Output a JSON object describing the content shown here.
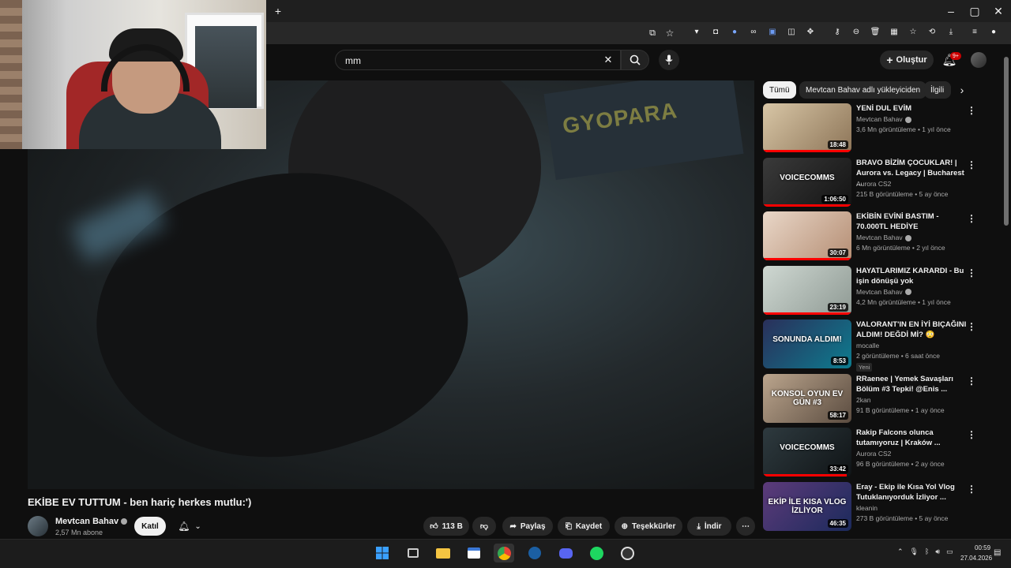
{
  "browser": {
    "new_tab_label": "+",
    "window_controls": [
      "minimize",
      "maximize",
      "close"
    ]
  },
  "youtube": {
    "search_value": "mm",
    "create_label": "Oluştur",
    "notification_badge": "9+"
  },
  "video": {
    "title": "EKİBE EV TUTTUM - ben hariç herkes mutlu:')",
    "sign_text": "GYOPARA",
    "channel_name": "Mevtcan Bahav",
    "subscribers": "2,57 Mn abone",
    "join_label": "Katıl",
    "likes": "113 B",
    "share_label": "Paylaş",
    "save_label": "Kaydet",
    "thanks_label": "Teşekkürler",
    "download_label": "İndir"
  },
  "chips": [
    "Tümü",
    "Mevtcan Bahav adlı yükleyiciden",
    "İlgili"
  ],
  "recommendations": [
    {
      "title": "YENİ DUL EVİM",
      "channel": "Mevtcan Bahav",
      "verified": true,
      "meta": "3,6 Mn görüntüleme • 1 yıl önce",
      "duration": "18:48",
      "progress": 1.0,
      "thumb": "linear-gradient(135deg,#d8c6a6,#8d7558)"
    },
    {
      "title": "BRAVO BİZİM ÇOCUKLAR! | Aurora vs. Legacy | Bucharest ...",
      "channel": "Aurora CS2",
      "verified": false,
      "meta": "215 B görüntüleme • 5 ay önce",
      "duration": "1:06:50",
      "progress": 1.0,
      "thumb_text": "VOICECOMMS",
      "thumb": "linear-gradient(135deg,#3a3a3a,#141414)"
    },
    {
      "title": "EKİBİN EVİNİ BASTIM - 70.000TL HEDİYE",
      "channel": "Mevtcan Bahav",
      "verified": true,
      "meta": "6 Mn görüntüleme • 2 yıl önce",
      "duration": "30:07",
      "progress": 1.0,
      "thumb": "linear-gradient(135deg,#e9d7c8,#b58e74)"
    },
    {
      "title": "HAYATLARIMIZ KARARDI - Bu işin dönüşü yok",
      "channel": "Mevtcan Bahav",
      "verified": true,
      "meta": "4,2 Mn görüntüleme • 1 yıl önce",
      "duration": "23:19",
      "progress": 1.0,
      "thumb": "linear-gradient(135deg,#cfd8d2,#8f9a94)"
    },
    {
      "title": "VALORANT'IN EN İYİ BIÇAĞINI ALDIM! DEĞDİ Mİ? 😳",
      "channel": "mocalle",
      "verified": false,
      "meta": "2 görüntüleme • 6 saat önce",
      "new": "Yeni",
      "duration": "8:53",
      "progress": 0,
      "thumb_text": "SONUNDA ALDIM!",
      "thumb": "linear-gradient(135deg,#2a2f5a,#0d7c8f)"
    },
    {
      "title": "RRaenee | Yemek Savaşları Bölüm #3 Tepki! @Enis ...",
      "channel": "2kan",
      "verified": false,
      "meta": "91 B görüntüleme • 1 ay önce",
      "duration": "58:17",
      "progress": 0,
      "thumb_text": "KONSOL OYUN EV GÜN #3",
      "thumb": "linear-gradient(135deg,#bba58d,#5b4c40)"
    },
    {
      "title": "Rakip Falcons olunca tutamıyoruz | Kraków ...",
      "channel": "Aurora CS2",
      "verified": false,
      "meta": "96 B görüntüleme • 2 ay önce",
      "duration": "33:42",
      "progress": 0.95,
      "thumb_text": "VOICECOMMS",
      "thumb": "linear-gradient(135deg,#2e3a3f,#101416)"
    },
    {
      "title": "Eray - Ekip ile Kısa Yol Vlog Tutuklanıyorduk İzliyor ...",
      "channel": "kleanin",
      "verified": false,
      "meta": "273 B görüntüleme • 5 ay önce",
      "duration": "46:35",
      "progress": 0,
      "thumb_text": "EKİP İLE KISA VLOG İZLİYOR",
      "thumb": "linear-gradient(135deg,#5d3b7a,#1b2a5c)"
    }
  ],
  "taskbar": {
    "time": "00:59",
    "date": "27.04.2026"
  },
  "colors": {
    "background": "#0f0f0f",
    "accent_red": "#ff0000",
    "chip_active": "#f1f1f1"
  }
}
